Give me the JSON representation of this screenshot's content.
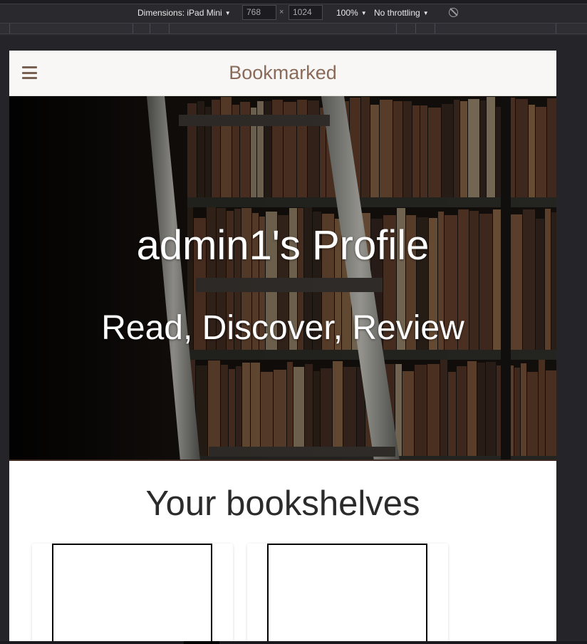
{
  "devtools": {
    "device_label": "Dimensions: iPad Mini",
    "width_value": "768",
    "height_value": "1024",
    "dimension_separator": "×",
    "zoom_label": "100%",
    "throttle_label": "No throttling"
  },
  "navbar": {
    "brand": "Bookmarked",
    "menu_icon": "hamburger-menu-icon"
  },
  "hero": {
    "title": "admin1's Profile",
    "tagline": "Read, Discover, Review"
  },
  "shelves": {
    "heading": "Your bookshelves",
    "cards": [
      {
        "cover": "blank"
      },
      {
        "cover": "blank"
      }
    ]
  },
  "colors": {
    "brand": "#8a6a59",
    "navbar_bg": "#f8f7f6",
    "hero_bg": "#0e0b09",
    "devtools_bg": "#2a2a2e"
  }
}
